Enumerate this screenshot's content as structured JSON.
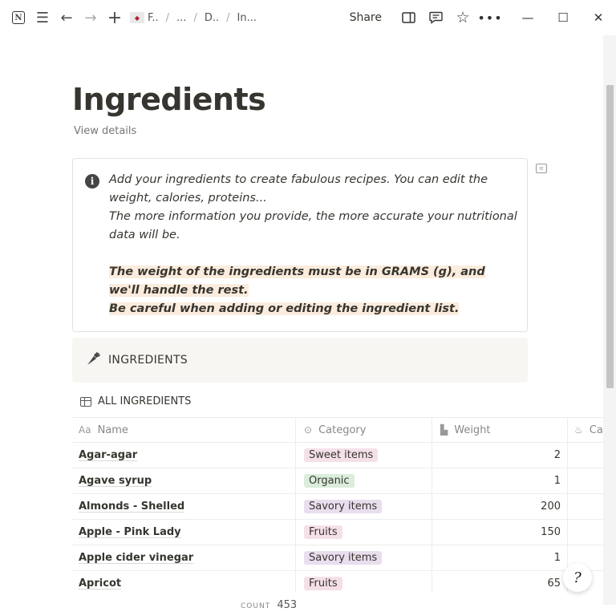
{
  "titlebar": {
    "crumbs": [
      "F..",
      "...",
      "D..",
      "In..."
    ],
    "share_label": "Share"
  },
  "page": {
    "title": "Ingredients",
    "view_details": "View details"
  },
  "callout": {
    "line1": "Add your ingredients to create fabulous recipes. You can edit the weight, calories, proteins...",
    "line2": "The more information you provide, the more accurate your nutritional data will be.",
    "highlight1": "The weight of the ingredients must be in GRAMS (g), and we'll handle the rest.",
    "highlight2": "Be careful when adding or editing the ingredient list."
  },
  "section": {
    "label": "INGREDIENTS"
  },
  "database": {
    "title": "ALL INGREDIENTS",
    "columns": [
      "Name",
      "Category",
      "Weight",
      "Ca"
    ],
    "rows": [
      {
        "name": "Agar-agar",
        "category": "Sweet items",
        "weight": "2"
      },
      {
        "name": "Agave syrup",
        "category": "Organic",
        "weight": "1"
      },
      {
        "name": "Almonds - Shelled",
        "category": "Savory items",
        "weight": "200"
      },
      {
        "name": "Apple - Pink Lady",
        "category": "Fruits",
        "weight": "150"
      },
      {
        "name": "Apple cider vinegar",
        "category": "Savory items",
        "weight": "1"
      },
      {
        "name": "Apricot",
        "category": "Fruits",
        "weight": "65"
      }
    ],
    "count_label": "COUNT",
    "count_value": "453"
  },
  "colors": {
    "tag_sweet": "#f5e0e9",
    "tag_organic": "#dbeddb",
    "tag_savory": "#e8deee",
    "tag_fruits": "#f5e0e9",
    "callout_highlight": "#fbecdd"
  }
}
